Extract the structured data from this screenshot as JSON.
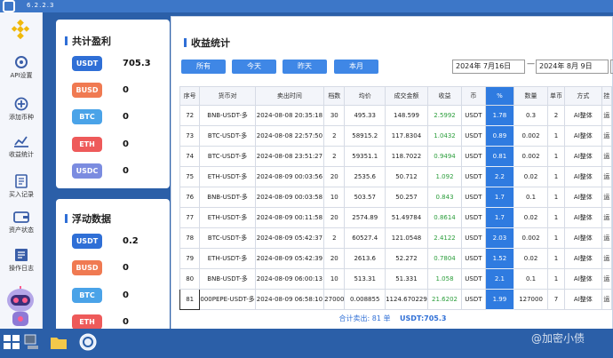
{
  "app": {
    "version": "6.2.2.3"
  },
  "sidebar": {
    "items": [
      {
        "label": "API设置",
        "icon": "gear-icon"
      },
      {
        "label": "添加币种",
        "icon": "add-coin-icon"
      },
      {
        "label": "收益统计",
        "icon": "chart-icon"
      },
      {
        "label": "买入记录",
        "icon": "buy-record-icon"
      },
      {
        "label": "资产状态",
        "icon": "wallet-icon"
      },
      {
        "label": "操作日志",
        "icon": "log-icon"
      }
    ]
  },
  "profit_panel": {
    "title": "共计盈利",
    "rows": [
      {
        "currency": "USDT",
        "value": "705.3",
        "color": "#2f6fd6"
      },
      {
        "currency": "BUSD",
        "value": "0",
        "color": "#f07a52"
      },
      {
        "currency": "BTC",
        "value": "0",
        "color": "#4aa3e8"
      },
      {
        "currency": "ETH",
        "value": "0",
        "color": "#ee5a5a"
      },
      {
        "currency": "USDC",
        "value": "0",
        "color": "#7b8ce0"
      }
    ]
  },
  "float_panel": {
    "title": "浮动数据",
    "rows": [
      {
        "currency": "USDT",
        "value": "0.2",
        "color": "#2f6fd6"
      },
      {
        "currency": "BUSD",
        "value": "0",
        "color": "#f07a52"
      },
      {
        "currency": "BTC",
        "value": "0",
        "color": "#4aa3e8"
      },
      {
        "currency": "ETH",
        "value": "0",
        "color": "#ee5a5a"
      }
    ]
  },
  "dialog": {
    "title": "收益统计",
    "filters": [
      "所有",
      "今天",
      "昨天",
      "本月"
    ],
    "date_from": "2024年 7月16日",
    "date_sep": "—",
    "date_to": "2024年  8月  9日",
    "columns": [
      "序号",
      "货币对",
      "卖出时间",
      "档数",
      "均价",
      "成交金额",
      "收益",
      "币",
      "%",
      "数量",
      "单币",
      "方式",
      "挂"
    ],
    "rows": [
      [
        "72",
        "BNB-USDT-多",
        "2024-08-08 20:35:18",
        "30",
        "495.33",
        "148.599",
        "2.5992",
        "USDT",
        "1.78",
        "0.3",
        "2",
        "AI整体",
        "运"
      ],
      [
        "73",
        "BTC-USDT-多",
        "2024-08-08 22:57:50",
        "2",
        "58915.2",
        "117.8304",
        "1.0432",
        "USDT",
        "0.89",
        "0.002",
        "1",
        "AI整体",
        "运"
      ],
      [
        "74",
        "BTC-USDT-多",
        "2024-08-08 23:51:27",
        "2",
        "59351.1",
        "118.7022",
        "0.9494",
        "USDT",
        "0.81",
        "0.002",
        "1",
        "AI整体",
        "运"
      ],
      [
        "75",
        "ETH-USDT-多",
        "2024-08-09 00:03:56",
        "20",
        "2535.6",
        "50.712",
        "1.092",
        "USDT",
        "2.2",
        "0.02",
        "1",
        "AI整体",
        "运"
      ],
      [
        "76",
        "BNB-USDT-多",
        "2024-08-09 00:03:58",
        "10",
        "503.57",
        "50.257",
        "0.843",
        "USDT",
        "1.7",
        "0.1",
        "1",
        "AI整体",
        "运"
      ],
      [
        "77",
        "ETH-USDT-多",
        "2024-08-09 00:11:58",
        "20",
        "2574.89",
        "51.49784",
        "0.8614",
        "USDT",
        "1.7",
        "0.02",
        "1",
        "AI整体",
        "运"
      ],
      [
        "78",
        "BTC-USDT-多",
        "2024-08-09 05:42:37",
        "2",
        "60527.4",
        "121.0548",
        "2.4122",
        "USDT",
        "2.03",
        "0.002",
        "1",
        "AI整体",
        "运"
      ],
      [
        "79",
        "ETH-USDT-多",
        "2024-08-09 05:42:39",
        "20",
        "2613.6",
        "52.272",
        "0.7804",
        "USDT",
        "1.52",
        "0.02",
        "1",
        "AI整体",
        "运"
      ],
      [
        "80",
        "BNB-USDT-多",
        "2024-08-09 06:00:13",
        "10",
        "513.31",
        "51.331",
        "1.058",
        "USDT",
        "2.1",
        "0.1",
        "1",
        "AI整体",
        "运"
      ],
      [
        "81",
        "000PEPE-USDT-多",
        "2024-08-09 06:58:10",
        "27000",
        "0.008855",
        "1124.670229",
        "21.6202",
        "USDT",
        "1.99",
        "127000",
        "7",
        "AI整体",
        "运"
      ]
    ],
    "footer_count": "合计卖出: 81 单",
    "footer_total": "USDT:705.3"
  },
  "watermark": "@加密小债"
}
